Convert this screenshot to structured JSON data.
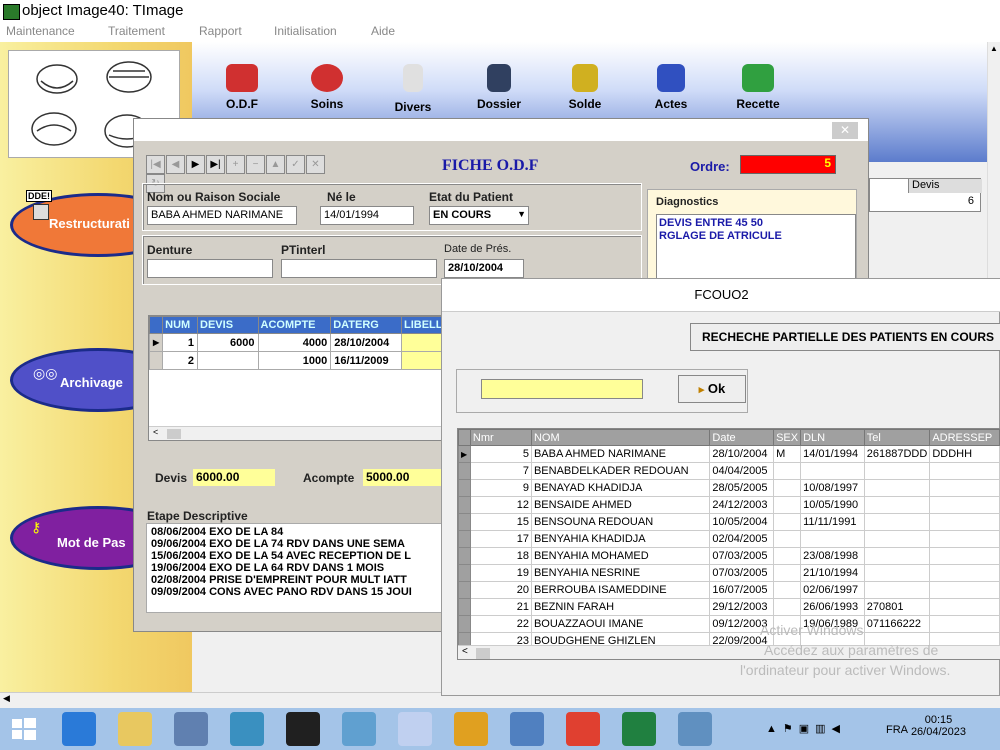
{
  "window_title": "object Image40: TImage",
  "menu": [
    "Maintenance",
    "Traitement",
    "Rapport",
    "Initialisation",
    "Aide"
  ],
  "toolbar": [
    {
      "label": "O.D.F",
      "icon": "teeth-icon",
      "color": "#d03030"
    },
    {
      "label": "Soins",
      "icon": "lips-icon",
      "color": "#d03030"
    },
    {
      "label": "Divers",
      "icon": "bottle-icon",
      "color": "#e0e0e0"
    },
    {
      "label": "Dossier",
      "icon": "person-icon",
      "color": "#304060"
    },
    {
      "label": "Solde",
      "icon": "coins-icon",
      "color": "#d0b020"
    },
    {
      "label": "Actes",
      "icon": "tubes-icon",
      "color": "#3050c0"
    },
    {
      "label": "Recette",
      "icon": "money-icon",
      "color": "#30a040"
    }
  ],
  "left_buttons": [
    {
      "label": "Restructurati",
      "icon": "calculator-icon",
      "badge": "DDE!",
      "color": "#f07838"
    },
    {
      "label": "Archivage",
      "icon": "discs-icon",
      "color": "#5050c8"
    },
    {
      "label": "Mot de Pas",
      "icon": "keys-icon",
      "color": "#8020a0"
    }
  ],
  "fiche": {
    "title": "FICHE  O.D.F",
    "ordre_label": "Ordre:",
    "ordre_value": "5",
    "nom_label": "Nom ou Raison Sociale",
    "nom_value": "BABA AHMED  NARIMANE",
    "ne_label": "Né le",
    "ne_value": "14/01/1994",
    "etat_label": "Etat du Patient",
    "etat_value": "EN COURS",
    "denture_label": "Denture",
    "denture_value": "",
    "ptinterl_label": "PTinterl",
    "ptinterl_value": "",
    "datepres_label": "Date de Prés.",
    "datepres_value": "28/10/2004",
    "diag_label": "Diagnostics",
    "diag_lines": [
      "DEVIS ENTRE 45 50",
      "RGLAGE DE ATRICULE"
    ],
    "grid_headers": [
      "NUM",
      "DEVIS",
      "ACOMPTE",
      "DATERG",
      "LIBELL"
    ],
    "grid_rows": [
      [
        "1",
        "6000",
        "4000",
        "28/10/2004",
        ""
      ],
      [
        "2",
        "",
        "1000",
        "16/11/2009",
        ""
      ]
    ],
    "devis_label": "Devis",
    "devis_value": "6000.00",
    "acompte_label": "Acompte",
    "acompte_value": "5000.00",
    "etape_label": "Etape  Descriptive",
    "etape_lines": [
      "08/06/2004  EXO DE LA 84",
      "09/06/2004  EXO  DE LA 74   RDV DANS UNE SEMA",
      "15/06/2004 EXO DE LA 54  AVEC RECEPTION DE L",
      "19/06/2004 EXO DE LA 64  RDV DANS 1 MOIS",
      "02/08/2004  PRISE D'EMPREINT POUR MULT IATT",
      "09/09/2004 CONS AVEC PANO  RDV DANS 15 JOUI"
    ],
    "side_header": "Devis",
    "side_value": "6"
  },
  "fcouo2": {
    "title": "FCOUO2",
    "search_button": "RECHECHE PARTIELLE DES PATIENTS EN COURS",
    "search_value": "",
    "ok_label": "Ok",
    "headers": [
      "Nmr",
      "NOM",
      "Date",
      "SEX",
      "DLN",
      "Tel",
      "ADRESSEP"
    ],
    "rows": [
      [
        "5",
        "BABA AHMED  NARIMANE",
        "28/10/2004",
        "M",
        "14/01/1994",
        "261887DDD",
        "DDDHH"
      ],
      [
        "7",
        "BENABDELKADER  REDOUAN",
        "04/04/2005",
        "",
        "",
        "",
        ""
      ],
      [
        "9",
        "BENAYAD  KHADIDJA",
        "28/05/2005",
        "",
        "10/08/1997",
        "",
        ""
      ],
      [
        "12",
        "BENSAIDE  AHMED",
        "24/12/2003",
        "",
        "10/05/1990",
        "",
        ""
      ],
      [
        "15",
        "BENSOUNA  REDOUAN",
        "10/05/2004",
        "",
        "11/11/1991",
        "",
        ""
      ],
      [
        "17",
        "BENYAHIA  KHADIDJA",
        "02/04/2005",
        "",
        "",
        "",
        ""
      ],
      [
        "18",
        "BENYAHIA  MOHAMED",
        "07/03/2005",
        "",
        "23/08/1998",
        "",
        ""
      ],
      [
        "19",
        "BENYAHIA  NESRINE",
        "07/03/2005",
        "",
        "21/10/1994",
        "",
        ""
      ],
      [
        "20",
        "BERROUBA  ISAMEDDINE",
        "16/07/2005",
        "",
        "02/06/1997",
        "",
        ""
      ],
      [
        "21",
        "BEZNIN  FARAH",
        "29/12/2003",
        "",
        "26/06/1993",
        "270801",
        ""
      ],
      [
        "22",
        "BOUAZZAOUI  IMANE",
        "09/12/2003",
        "",
        "19/06/1989",
        "071166222",
        ""
      ],
      [
        "23",
        "BOUDGHENE  GHIZLEN",
        "22/09/2004",
        "",
        "",
        "",
        ""
      ]
    ]
  },
  "watermark": [
    "Activer Windows",
    "Accédez aux paramètres de",
    "l'ordinateur pour activer Windows."
  ],
  "taskbar": {
    "lang": "FRA",
    "time": "00:15",
    "date": "26/04/2023",
    "apps": [
      {
        "name": "ie-icon",
        "color": "#2a7ad8"
      },
      {
        "name": "explorer-icon",
        "color": "#e8c860"
      },
      {
        "name": "computer-icon",
        "color": "#6080b0"
      },
      {
        "name": "globe-icon",
        "color": "#3a90c0"
      },
      {
        "name": "terminal-icon",
        "color": "#202020"
      },
      {
        "name": "book-icon",
        "color": "#60a0d0"
      },
      {
        "name": "paint-icon",
        "color": "#c0d0f0"
      },
      {
        "name": "seven-icon",
        "color": "#e0a020"
      },
      {
        "name": "photo-icon",
        "color": "#5080c0"
      },
      {
        "name": "chrome-icon",
        "color": "#e04030"
      },
      {
        "name": "app-icon",
        "color": "#208040"
      },
      {
        "name": "monitor-icon",
        "color": "#6090c0"
      }
    ]
  }
}
